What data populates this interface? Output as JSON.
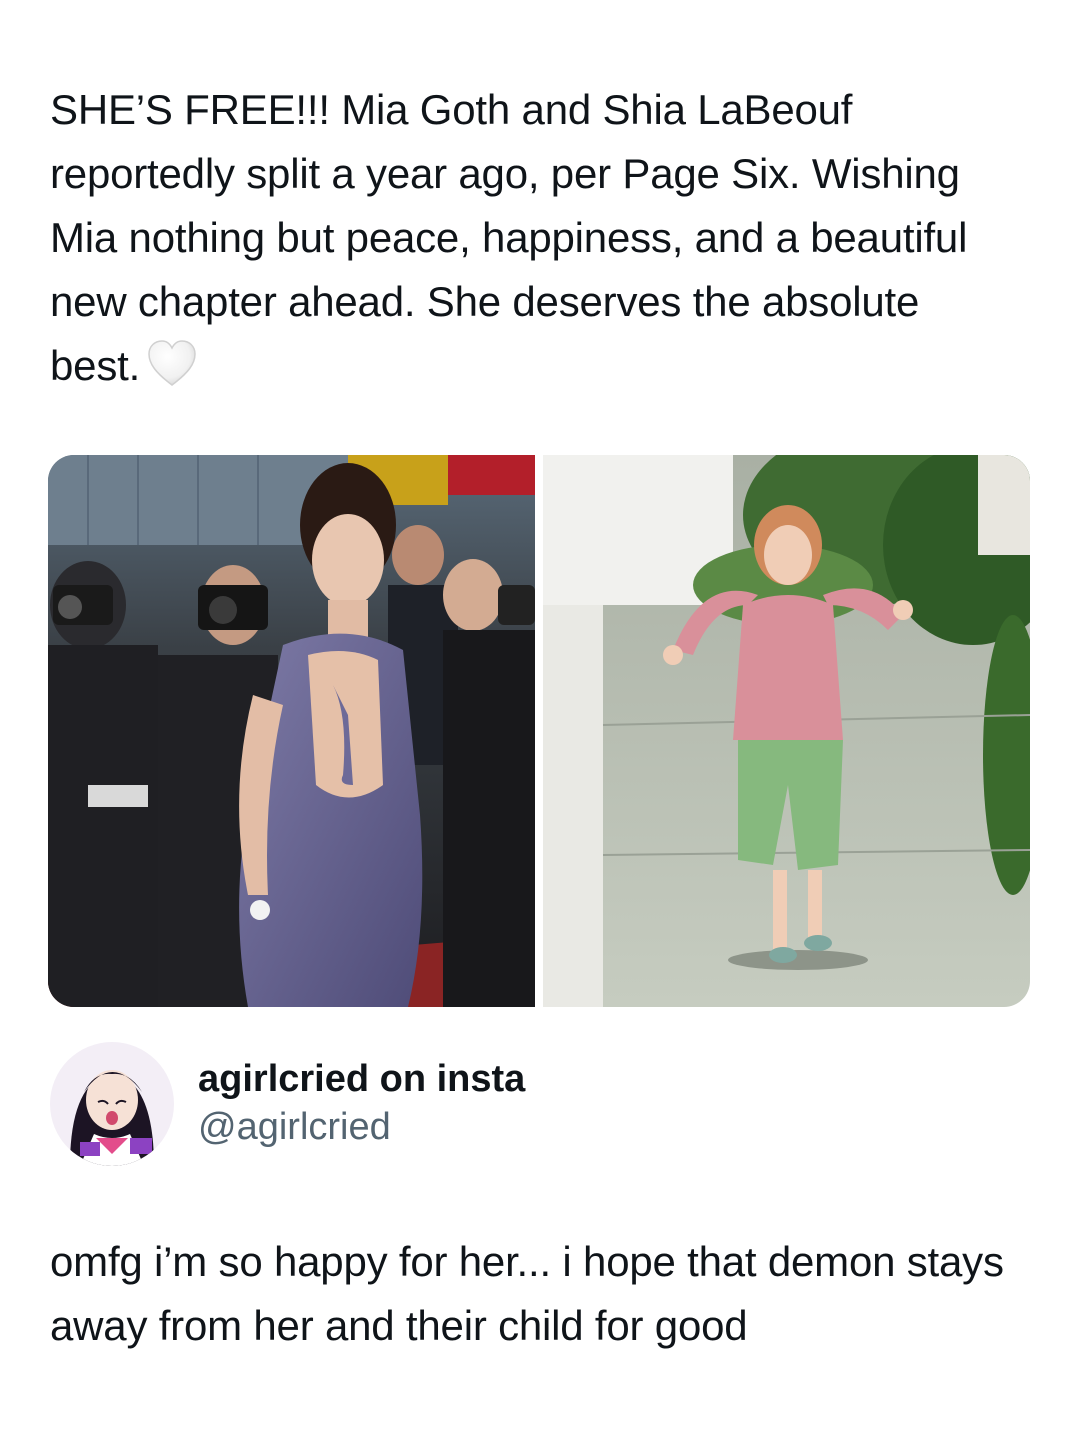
{
  "post": {
    "text": "SHE’S FREE!!! Mia Goth and Shia LaBeouf reportedly split a year ago, per Page Six. Wishing Mia nothing but peace, happiness, and a beautiful new chapter ahead. She deserves the absolute best.",
    "emoji": "white-heart-icon"
  },
  "media": {
    "images": [
      {
        "name": "red-carpet-photo",
        "alt": ""
      },
      {
        "name": "celebrating-woman-photo",
        "alt": ""
      }
    ]
  },
  "author": {
    "display_name": "agirlcried on insta",
    "handle": "@agirlcried",
    "avatar_icon": "anime-avatar-icon"
  },
  "reply": {
    "text": "omfg i’m so happy for her... i hope that demon stays away from her and their child for good"
  },
  "colors": {
    "text": "#0f1419",
    "secondary_text": "#536471",
    "background": "#ffffff"
  }
}
